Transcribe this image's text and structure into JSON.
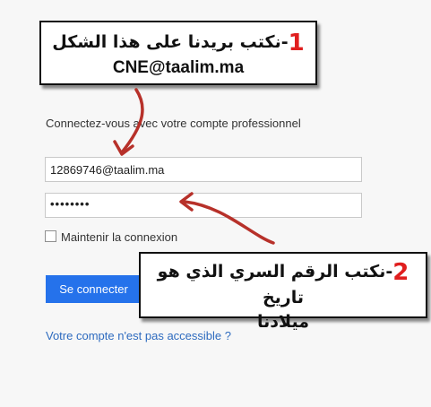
{
  "callout1": {
    "number": "1",
    "text": "-نكتب بريدنا على هذا الشكل",
    "example": "CNE@taalim.ma"
  },
  "callout2": {
    "number": "2",
    "text": "-نكتب الرقم السري الذي هو تاريخ",
    "text_line2": "ميلادنا"
  },
  "login": {
    "heading": "Connectez-vous avec votre compte professionnel",
    "email_value": "12869746@taalim.ma",
    "password_value": "••••••••",
    "remember_label": "Maintenir la connexion",
    "remember_checked": false,
    "signin_label": "Se connecter",
    "help_link": "Votre compte n'est pas accessible ?"
  },
  "colors": {
    "button": "#2572eb",
    "link": "#2e6bbf",
    "arrow": "#b7312a",
    "number": "#e01e1e"
  }
}
